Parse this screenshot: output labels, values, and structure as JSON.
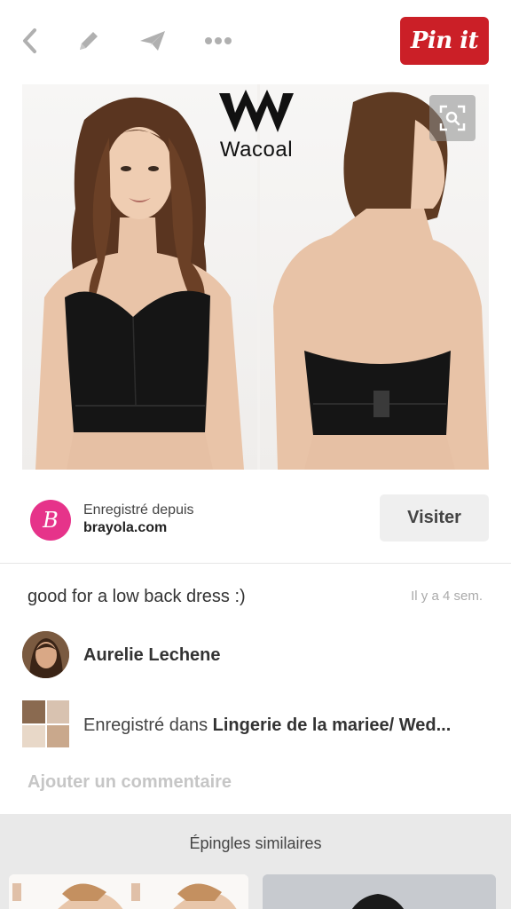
{
  "toolbar": {
    "icons": [
      "back-arrow-icon",
      "edit-pencil-icon",
      "send-icon",
      "more-dots-icon"
    ],
    "pin_label": "Pin it",
    "pin_color": "#cb1f27"
  },
  "pin": {
    "image_alt": "Wacoal strapless longline bra, front and back views",
    "brand_logo_text": "Wacoal",
    "zoom_icon": "visual-search-icon"
  },
  "source": {
    "saved_from_label": "Enregistré depuis",
    "domain": "brayola.com",
    "logo_letter": "B",
    "logo_color": "#e6338a",
    "visit_label": "Visiter"
  },
  "details": {
    "description": "good for a low back dress :)",
    "timestamp": "Il y a 4 sem."
  },
  "pinner": {
    "name": "Aurelie Lechene"
  },
  "board": {
    "saved_in_label": "Enregistré dans",
    "board_name": "Lingerie de la mariee/ Wed..."
  },
  "comment": {
    "prompt": "Ajouter un commentaire"
  },
  "similar": {
    "title": "Épingles similaires"
  }
}
